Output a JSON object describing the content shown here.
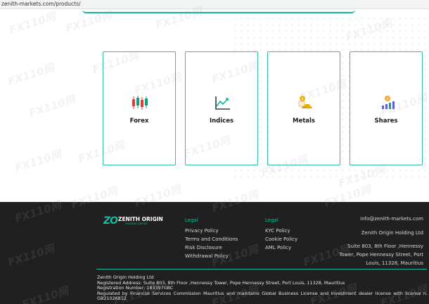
{
  "browser": {
    "url": "zenith-markets.com/products/"
  },
  "products": [
    {
      "label": "Forex",
      "icon": "candlestick-chart-icon"
    },
    {
      "label": "Indices",
      "icon": "line-chart-icon"
    },
    {
      "label": "Metals",
      "icon": "gold-bars-icon"
    },
    {
      "label": "Shares",
      "icon": "shares-bar-chart-icon"
    }
  ],
  "footer": {
    "logo": {
      "mark": "ZO",
      "name": "ZENITH ORIGIN",
      "tagline": "HOLDING LIMITED"
    },
    "col1": {
      "heading": "Legal",
      "links": [
        "Privacy Policy",
        "Terms and Conditions",
        "Risk Disclosure",
        "Withdrawal Policy"
      ]
    },
    "col2": {
      "heading": "Legal",
      "links": [
        "KYC Policy",
        "Cookie Policy",
        "AML Policy"
      ]
    },
    "contact": {
      "email": "info@zenith-markets.com",
      "company": "Zenith Origin Holding Ltd",
      "address": "Suite 803, 8th Floor ,Hennessy Tower, Pope Hennessy Street, Port Louis, 11328, Mauritius"
    },
    "legal_text": {
      "company": "Zenith Origin Holding Ltd",
      "registered_address": "Registered Address: Suite 803, 8th Floor ,Hennessy Tower, Pope Hennessy Street, Port Louis, 11328, Mauritius",
      "registration": "Registration Number: 183397GBC",
      "regulation": "Regulated by Financial Services Commission Mauritius and maintains Global Business License and Investment dealer license with license n. GB21026812"
    }
  },
  "watermark": "FX110网",
  "colors": {
    "accent": "#1fb89c",
    "footer_bg": "#202020"
  }
}
